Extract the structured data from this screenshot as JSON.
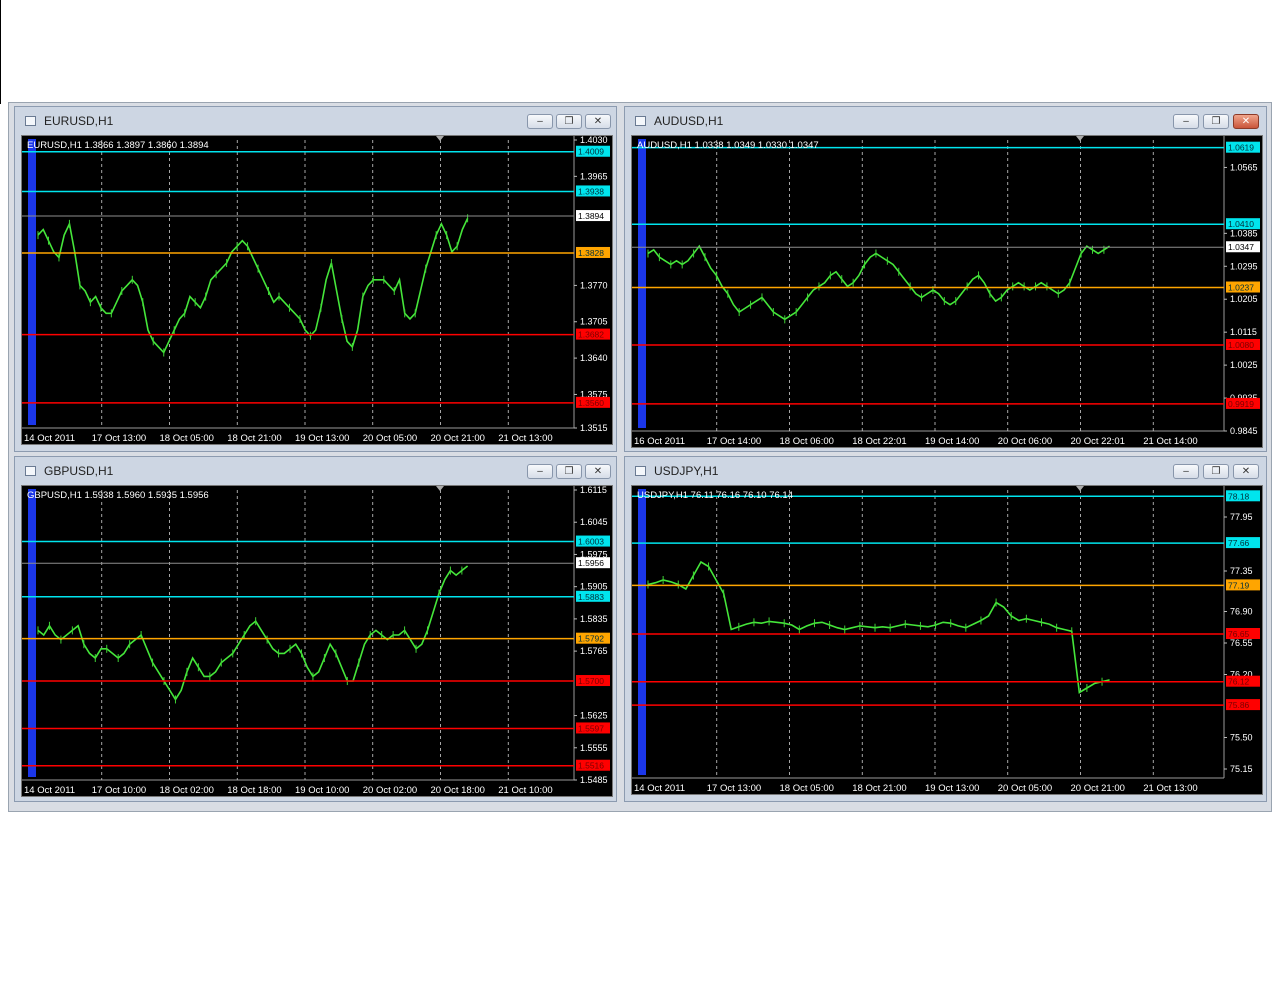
{
  "windows": [
    {
      "title": "EURUSD,H1",
      "header": "EURUSD,H1  1.3866 1.3897 1.3860 1.3894",
      "price_ticks": [
        "1.4030",
        "1.3965",
        "1.3770",
        "1.3705",
        "1.3640",
        "1.3575",
        "1.3515"
      ],
      "x_labels": [
        "14 Oct 2011",
        "17 Oct 13:00",
        "18 Oct 05:00",
        "18 Oct 21:00",
        "19 Oct 13:00",
        "20 Oct 05:00",
        "20 Oct 21:00",
        "21 Oct 13:00"
      ],
      "lines": [
        {
          "value": "1.4009",
          "color": "#00e5ee"
        },
        {
          "value": "1.3938",
          "color": "#00e5ee"
        },
        {
          "value": "1.3894",
          "color": "#ffffff"
        },
        {
          "value": "1.3828",
          "color": "#ffa500"
        },
        {
          "value": "1.3682",
          "color": "#ff0000"
        },
        {
          "value": "1.3560",
          "color": "#ff0000"
        }
      ],
      "close_color": "#ffffff"
    },
    {
      "title": "AUDUSD,H1",
      "header": "AUDUSD,H1  1.0338 1.0349 1.0330 1.0347",
      "price_ticks": [
        "1.0565",
        "1.0385",
        "1.0295",
        "1.0205",
        "1.0115",
        "1.0025",
        "0.9935",
        "0.9845"
      ],
      "x_labels": [
        "16 Oct 2011",
        "17 Oct 14:00",
        "18 Oct 06:00",
        "18 Oct 22:01",
        "19 Oct 14:00",
        "20 Oct 06:00",
        "20 Oct 22:01",
        "21 Oct 14:00"
      ],
      "lines": [
        {
          "value": "1.0619",
          "color": "#00e5ee"
        },
        {
          "value": "1.0410",
          "color": "#00e5ee"
        },
        {
          "value": "1.0347",
          "color": "#ffffff"
        },
        {
          "value": "1.0237",
          "color": "#ffa500"
        },
        {
          "value": "1.0080",
          "color": "#ff0000"
        },
        {
          "value": "0.9919",
          "color": "#ff0000"
        }
      ]
    },
    {
      "title": "GBPUSD,H1",
      "header": "GBPUSD,H1  1.5938 1.5960 1.5935 1.5956",
      "price_ticks": [
        "1.6115",
        "1.6045",
        "1.5975",
        "1.5905",
        "1.5835",
        "1.5765",
        "1.5625",
        "1.5555",
        "1.5485"
      ],
      "x_labels": [
        "14 Oct 2011",
        "17 Oct 10:00",
        "18 Oct 02:00",
        "18 Oct 18:00",
        "19 Oct 10:00",
        "20 Oct 02:00",
        "20 Oct 18:00",
        "21 Oct 10:00"
      ],
      "lines": [
        {
          "value": "1.6003",
          "color": "#00e5ee"
        },
        {
          "value": "1.5956",
          "color": "#ffffff"
        },
        {
          "value": "1.5883",
          "color": "#00e5ee"
        },
        {
          "value": "1.5792",
          "color": "#ffa500"
        },
        {
          "value": "1.5700",
          "color": "#ff0000"
        },
        {
          "value": "1.5597",
          "color": "#ff0000"
        },
        {
          "value": "1.5516",
          "color": "#ff0000"
        }
      ]
    },
    {
      "title": "USDJPY,H1",
      "header": "USDJPY,H1  76.11 76.16 76.10 76.14",
      "price_ticks": [
        "77.95",
        "77.35",
        "76.90",
        "76.55",
        "76.20",
        "75.50",
        "75.15"
      ],
      "x_labels": [
        "14 Oct 2011",
        "17 Oct 13:00",
        "18 Oct 05:00",
        "18 Oct 21:00",
        "19 Oct 13:00",
        "20 Oct 05:00",
        "20 Oct 21:00",
        "21 Oct 13:00"
      ],
      "lines": [
        {
          "value": "78.18",
          "color": "#00e5ee"
        },
        {
          "value": "77.66",
          "color": "#00e5ee"
        },
        {
          "value": "77.19",
          "color": "#ffa500"
        },
        {
          "value": "76.65",
          "color": "#ff0000"
        },
        {
          "value": "76.12",
          "color": "#ff0000"
        },
        {
          "value": "75.86",
          "color": "#ff0000"
        }
      ]
    }
  ],
  "chart_data": [
    {
      "type": "line",
      "title": "EURUSD,H1",
      "ylim": [
        1.3515,
        1.403
      ],
      "values": [
        1.386,
        1.387,
        1.385,
        1.383,
        1.382,
        1.386,
        1.388,
        1.383,
        1.377,
        1.376,
        1.374,
        1.375,
        1.373,
        1.372,
        1.372,
        1.374,
        1.376,
        1.377,
        1.378,
        1.377,
        1.374,
        1.369,
        1.367,
        1.366,
        1.365,
        1.367,
        1.369,
        1.371,
        1.372,
        1.375,
        1.374,
        1.373,
        1.375,
        1.378,
        1.379,
        1.38,
        1.381,
        1.383,
        1.384,
        1.385,
        1.384,
        1.382,
        1.38,
        1.378,
        1.376,
        1.374,
        1.375,
        1.374,
        1.373,
        1.372,
        1.371,
        1.369,
        1.368,
        1.369,
        1.373,
        1.378,
        1.381,
        1.376,
        1.371,
        1.367,
        1.366,
        1.369,
        1.375,
        1.377,
        1.378,
        1.378,
        1.378,
        1.377,
        1.376,
        1.378,
        1.372,
        1.371,
        1.372,
        1.376,
        1.38,
        1.383,
        1.386,
        1.388,
        1.386,
        1.383,
        1.384,
        1.387,
        1.389
      ]
    },
    {
      "type": "line",
      "title": "AUDUSD,H1",
      "ylim": [
        0.9845,
        1.064
      ],
      "values": [
        1.033,
        1.034,
        1.032,
        1.031,
        1.03,
        1.031,
        1.03,
        1.031,
        1.033,
        1.035,
        1.032,
        1.029,
        1.027,
        1.024,
        1.022,
        1.019,
        1.017,
        1.018,
        1.019,
        1.02,
        1.021,
        1.019,
        1.017,
        1.016,
        1.015,
        1.016,
        1.017,
        1.019,
        1.021,
        1.023,
        1.024,
        1.025,
        1.027,
        1.028,
        1.026,
        1.024,
        1.025,
        1.027,
        1.03,
        1.032,
        1.033,
        1.032,
        1.031,
        1.03,
        1.028,
        1.026,
        1.024,
        1.022,
        1.021,
        1.022,
        1.023,
        1.022,
        1.02,
        1.019,
        1.02,
        1.022,
        1.024,
        1.026,
        1.027,
        1.025,
        1.022,
        1.02,
        1.021,
        1.023,
        1.024,
        1.025,
        1.024,
        1.023,
        1.024,
        1.025,
        1.024,
        1.023,
        1.022,
        1.023,
        1.025,
        1.029,
        1.033,
        1.035,
        1.034,
        1.033,
        1.034,
        1.035
      ]
    },
    {
      "type": "line",
      "title": "GBPUSD,H1",
      "ylim": [
        1.5485,
        1.6115
      ],
      "values": [
        1.581,
        1.58,
        1.582,
        1.58,
        1.579,
        1.58,
        1.581,
        1.582,
        1.578,
        1.576,
        1.575,
        1.577,
        1.577,
        1.576,
        1.575,
        1.576,
        1.578,
        1.579,
        1.58,
        1.577,
        1.574,
        1.572,
        1.57,
        1.568,
        1.566,
        1.568,
        1.572,
        1.575,
        1.573,
        1.571,
        1.571,
        1.572,
        1.574,
        1.575,
        1.576,
        1.578,
        1.58,
        1.582,
        1.583,
        1.581,
        1.579,
        1.577,
        1.576,
        1.576,
        1.577,
        1.578,
        1.576,
        1.573,
        1.571,
        1.572,
        1.575,
        1.578,
        1.576,
        1.573,
        1.57,
        1.57,
        1.574,
        1.578,
        1.58,
        1.581,
        1.58,
        1.579,
        1.58,
        1.58,
        1.581,
        1.579,
        1.577,
        1.578,
        1.581,
        1.585,
        1.589,
        1.592,
        1.594,
        1.593,
        1.594,
        1.595
      ]
    },
    {
      "type": "line",
      "title": "USDJPY,H1",
      "ylim": [
        75.05,
        78.25
      ],
      "values": [
        77.2,
        77.22,
        77.25,
        77.23,
        77.2,
        77.15,
        77.3,
        77.45,
        77.4,
        77.25,
        77.1,
        76.7,
        76.73,
        76.76,
        76.78,
        76.77,
        76.79,
        76.78,
        76.77,
        76.75,
        76.7,
        76.74,
        76.77,
        76.78,
        76.75,
        76.72,
        76.7,
        76.72,
        76.74,
        76.73,
        76.72,
        76.73,
        76.72,
        76.74,
        76.76,
        76.75,
        76.74,
        76.73,
        76.75,
        76.78,
        76.77,
        76.74,
        76.72,
        76.76,
        76.8,
        76.85,
        77.0,
        76.95,
        76.85,
        76.8,
        76.82,
        76.8,
        76.78,
        76.76,
        76.72,
        76.7,
        76.68,
        76.0,
        76.05,
        76.1,
        76.12,
        76.14
      ]
    }
  ]
}
